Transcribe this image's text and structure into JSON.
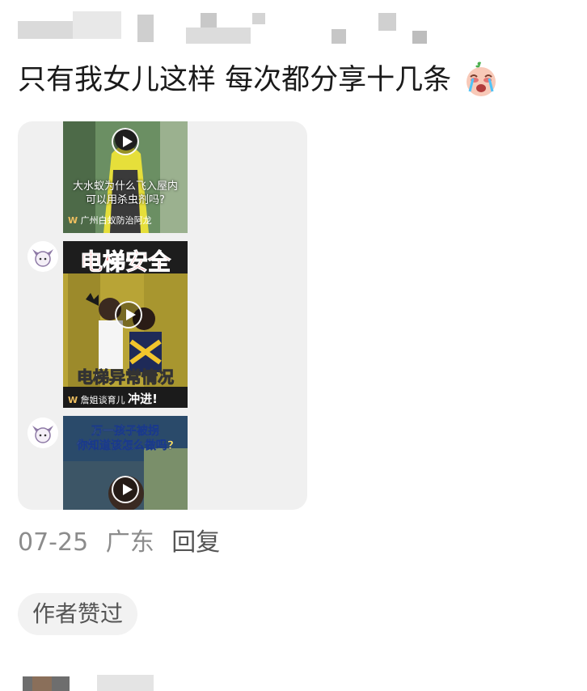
{
  "comment": {
    "text": "只有我女儿这样 每次都分享十几条",
    "emoji": "crying-face-emoji"
  },
  "shared_videos": [
    {
      "caption_line1": "大水蚁为什么飞入屋内",
      "caption_line2": "可以用杀虫剂吗?",
      "source": "广州白蚁防治阿龙"
    },
    {
      "title": "电梯安全",
      "subtitle": "电梯异常情况",
      "source": "詹姐谈育儿",
      "tag": "冲进!"
    },
    {
      "caption_line1": "万一孩子被拐",
      "caption_line2": "你知道该怎么做吗?"
    }
  ],
  "meta": {
    "date": "07-25",
    "location": "广东",
    "reply": "回复"
  },
  "badge": {
    "label": "作者赞过"
  }
}
